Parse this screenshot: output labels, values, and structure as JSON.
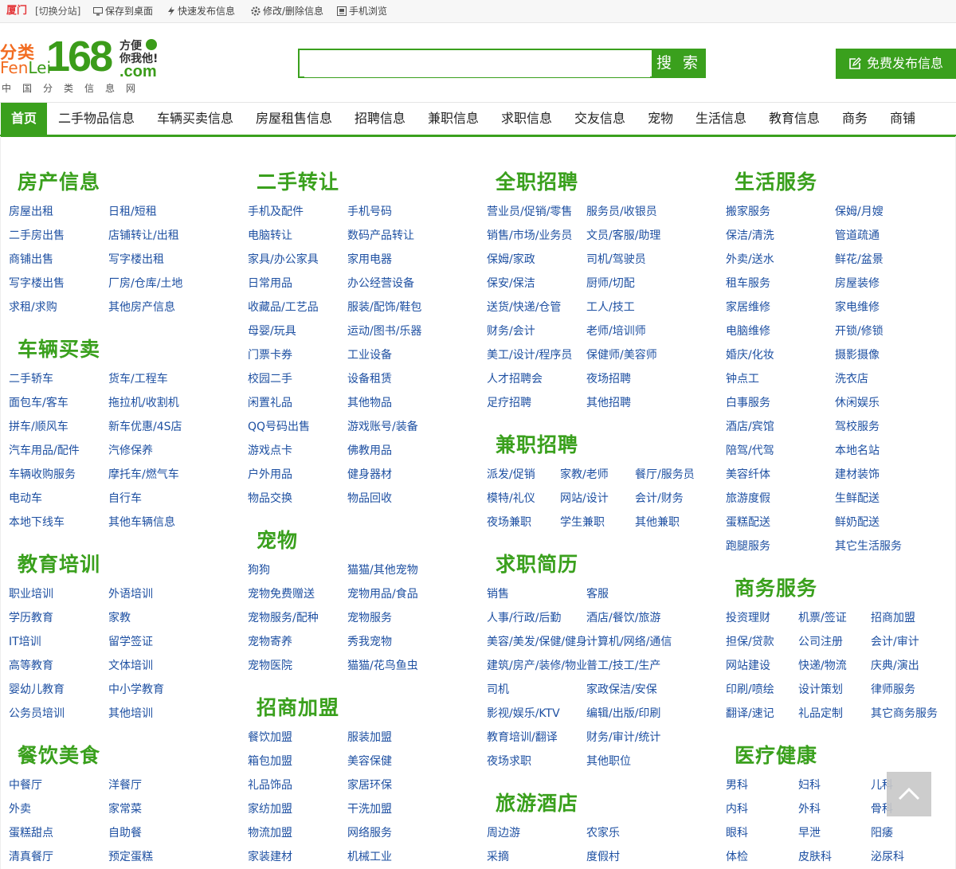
{
  "topbar": {
    "city": "厦门",
    "switch": "[切换分站]",
    "links": [
      {
        "label": "保存到桌面",
        "icon": "monitor-icon"
      },
      {
        "label": "快速发布信息",
        "icon": "lightning-icon"
      },
      {
        "label": "修改/删除信息",
        "icon": "gear-icon"
      },
      {
        "label": "手机浏览",
        "icon": "phone-icon"
      }
    ]
  },
  "logo": {
    "fenlei": "分类",
    "fenlei_en_a": "Fen",
    "fenlei_en_b": "Lei",
    "num": "168",
    "slogan1": "方便",
    "slogan2": "你我他!",
    "dotcom": ".com",
    "cn": "中国分类信息网"
  },
  "search": {
    "placeholder": "",
    "button": "搜 索"
  },
  "publish_button": "免费发布信息",
  "nav": [
    "首页",
    "二手物品信息",
    "车辆买卖信息",
    "房屋租售信息",
    "招聘信息",
    "兼职信息",
    "求职信息",
    "交友信息",
    "宠物",
    "生活信息",
    "教育信息",
    "商务",
    "商铺"
  ],
  "sections": [
    {
      "title": "房产信息",
      "links": [
        "房屋出租",
        "日租/短租",
        "二手房出售",
        "店铺转让/出租",
        "商铺出售",
        "写字楼出租",
        "写字楼出售",
        "厂房/仓库/土地",
        "求租/求购",
        "其他房产信息"
      ]
    },
    {
      "title": "车辆买卖",
      "links": [
        "二手轿车",
        "货车/工程车",
        "面包车/客车",
        "拖拉机/收割机",
        "拼车/顺风车",
        "新车优惠/4S店",
        "汽车用品/配件",
        "汽修保养",
        "车辆收购服务",
        "摩托车/燃气车",
        "电动车",
        "自行车",
        "本地下线车",
        "其他车辆信息"
      ]
    },
    {
      "title": "教育培训",
      "links": [
        "职业培训",
        "外语培训",
        "学历教育",
        "家教",
        "IT培训",
        "留学签证",
        "高等教育",
        "文体培训",
        "婴幼儿教育",
        "中小学教育",
        "公务员培训",
        "其他培训"
      ]
    },
    {
      "title": "餐饮美食",
      "links": [
        "中餐厅",
        "洋餐厅",
        "外卖",
        "家常菜",
        "蛋糕甜点",
        "自助餐",
        "清真餐厅",
        "预定蛋糕"
      ]
    },
    {
      "title": "二手转让",
      "links": [
        "手机及配件",
        "手机号码",
        "电脑转让",
        "数码产品转让",
        "家具/办公家具",
        "家用电器",
        "日常用品",
        "办公经营设备",
        "收藏品/工艺品",
        "服装/配饰/鞋包",
        "母婴/玩具",
        "运动/图书/乐器",
        "门票卡券",
        "工业设备",
        "校园二手",
        "设备租赁",
        "闲置礼品",
        "其他物品",
        "QQ号码出售",
        "游戏账号/装备",
        "游戏点卡",
        "佛教用品",
        "户外用品",
        "健身器材",
        "物品交换",
        "物品回收"
      ]
    },
    {
      "title": "宠物",
      "links": [
        "狗狗",
        "猫猫/其他宠物",
        "宠物免费赠送",
        "宠物用品/食品",
        "宠物服务/配种",
        "宠物服务",
        "宠物寄养",
        "秀我宠物",
        "宠物医院",
        "猫猫/花鸟鱼虫"
      ]
    },
    {
      "title": "招商加盟",
      "links": [
        "餐饮加盟",
        "服装加盟",
        "箱包加盟",
        "美容保健",
        "礼品饰品",
        "家居环保",
        "家纺加盟",
        "干洗加盟",
        "物流加盟",
        "网络服务",
        "家装建材",
        "机械工业"
      ]
    },
    {
      "title": "全职招聘",
      "links": [
        "营业员/促销/零售",
        "服务员/收银员",
        "销售/市场/业务员",
        "文员/客服/助理",
        "保姆/家政",
        "司机/驾驶员",
        "保安/保洁",
        "厨师/切配",
        "送货/快递/仓管",
        "工人/技工",
        "财务/会计",
        "老师/培训师",
        "美工/设计/程序员",
        "保健师/美容师",
        "人才招聘会",
        "夜场招聘",
        "足疗招聘",
        "其他招聘"
      ]
    },
    {
      "title": "兼职招聘",
      "links": [
        "派发/促销",
        "家教/老师",
        "餐厅/服务员",
        "模特/礼仪",
        "网站/设计",
        "会计/财务",
        "夜场兼职",
        "学生兼职",
        "其他兼职"
      ]
    },
    {
      "title": "求职简历",
      "links": [
        "销售",
        "客服",
        "人事/行政/后勤",
        "酒店/餐饮/旅游",
        "美容/美发/保健/健身",
        "计算机/网络/通信",
        "建筑/房产/装修/物业",
        "普工/技工/生产",
        "司机",
        "家政保洁/安保",
        "影视/娱乐/KTV",
        "编辑/出版/印刷",
        "教育培训/翻译",
        "财务/审计/统计",
        "夜场求职",
        "其他职位"
      ]
    },
    {
      "title": "旅游酒店",
      "links": [
        "周边游",
        "农家乐",
        "采摘",
        "度假村"
      ]
    },
    {
      "title": "生活服务",
      "links": [
        "搬家服务",
        "保姆/月嫂",
        "保洁/清洗",
        "管道疏通",
        "外卖/送水",
        "鲜花/盆景",
        "租车服务",
        "房屋装修",
        "家居维修",
        "家电维修",
        "电脑维修",
        "开锁/修锁",
        "婚庆/化妆",
        "摄影摄像",
        "钟点工",
        "洗衣店",
        "白事服务",
        "休闲娱乐",
        "酒店/宾馆",
        "驾校服务",
        "陪驾/代驾",
        "本地名站",
        "美容纤体",
        "建材装饰",
        "旅游度假",
        "生鲜配送",
        "蛋糕配送",
        "鲜奶配送",
        "跑腿服务",
        "其它生活服务"
      ]
    },
    {
      "title": "商务服务",
      "links": [
        "投资理财",
        "机票/签证",
        "招商加盟",
        "担保/贷款",
        "公司注册",
        "会计/审计",
        "网站建设",
        "快递/物流",
        "庆典/演出",
        "印刷/喷绘",
        "设计策划",
        "律师服务",
        "翻译/速记",
        "礼品定制",
        "其它商务服务"
      ]
    },
    {
      "title": "医疗健康",
      "links": [
        "男科",
        "妇科",
        "儿科",
        "内科",
        "外科",
        "骨科",
        "眼科",
        "早泄",
        "阳痿",
        "体检",
        "皮肤科",
        "泌尿科"
      ]
    }
  ],
  "icons": {
    "back_to_top": "chevron-up-icon",
    "publish": "edit-icon"
  },
  "colors": {
    "brand_green": "#3aa01d",
    "link_blue": "#1e50a2",
    "city_red": "#e4393c"
  }
}
